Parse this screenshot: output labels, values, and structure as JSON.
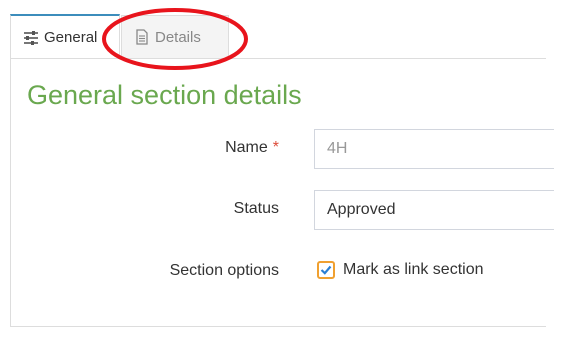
{
  "tabs": [
    {
      "label": "General",
      "icon": "sliders-icon",
      "active": true
    },
    {
      "label": "Details",
      "icon": "document-icon",
      "active": false
    }
  ],
  "section": {
    "title": "General section details"
  },
  "form": {
    "name": {
      "label": "Name",
      "required_marker": "*",
      "value": "4H"
    },
    "status": {
      "label": "Status",
      "value": "Approved"
    },
    "section_options": {
      "label": "Section options",
      "checkbox_label": "Mark as link section",
      "checked": true
    }
  },
  "colors": {
    "title_green": "#6aa84f",
    "active_tab_border": "#3c8dbc",
    "required_red": "#dd4b39",
    "annotation_red": "#e8141c",
    "checkbox_orange": "#f0a030",
    "checkmark_blue": "#2a7fd4"
  }
}
